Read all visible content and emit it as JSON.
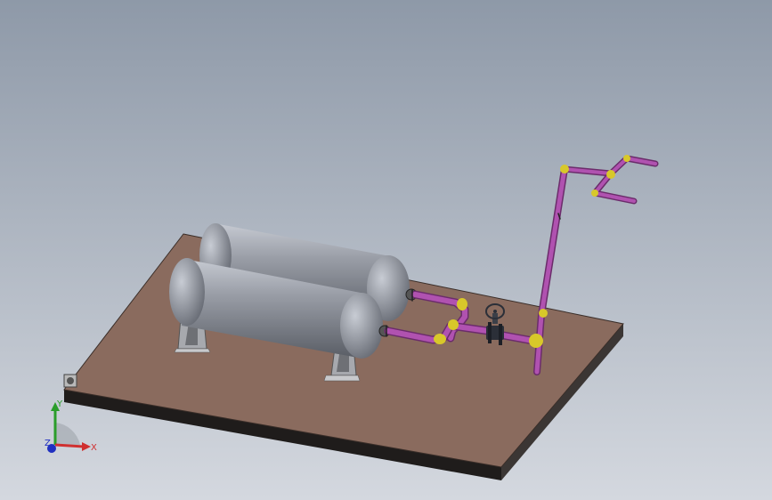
{
  "viewport": {
    "background_top": "#8e99a8",
    "background_bottom": "#d4d8df"
  },
  "colors": {
    "base_plate_top": "#8a6b5e",
    "base_plate_edge": "#2a2624",
    "tank_body": "#8c9099",
    "tank_highlight": "#c5c9d1",
    "tank_shadow": "#5a5e66",
    "support": "#a7a9ae",
    "pipe": "#b052b0",
    "pipe_dark": "#6b2c6b",
    "fitting": "#d8c82a",
    "valve": "#2b2f38"
  },
  "triad": {
    "x_label": "X",
    "y_label": "Y",
    "z_label": "Z",
    "x_color": "#d03030",
    "y_color": "#2a9d2a",
    "z_color": "#2030c0"
  },
  "scene_items": {
    "base_plate": "base-plate",
    "tank_back": "air-receiver-tank-rear",
    "tank_front": "air-receiver-tank-front",
    "piping": "process-piping",
    "valve": "gate-valve",
    "vent_stack": "vent-stack"
  }
}
